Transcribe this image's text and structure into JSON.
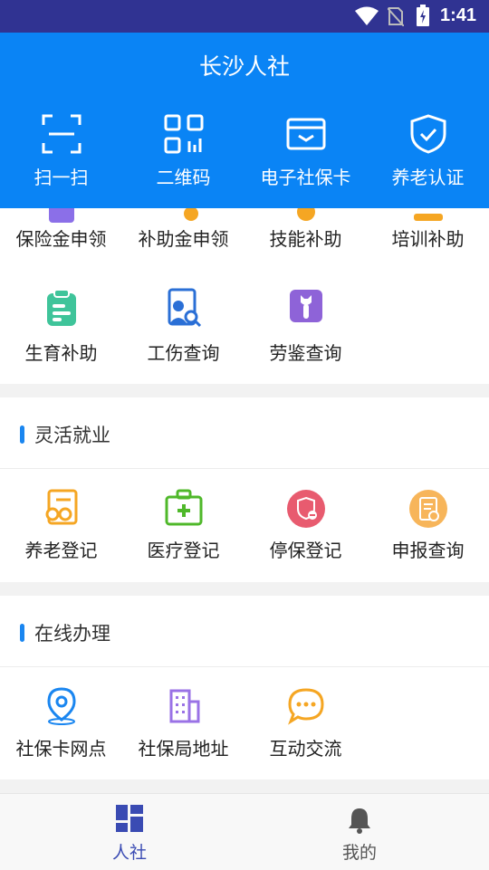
{
  "status_bar": {
    "time": "1:41"
  },
  "header": {
    "title": "长沙人社",
    "quick_actions": [
      {
        "label": "扫一扫",
        "icon": "scan-icon"
      },
      {
        "label": "二维码",
        "icon": "qrcode-icon"
      },
      {
        "label": "电子社保卡",
        "icon": "card-icon"
      },
      {
        "label": "养老认证",
        "icon": "shield-check-icon"
      }
    ]
  },
  "services": {
    "row1": [
      "保险金申领",
      "补助金申领",
      "技能补助",
      "培训补助"
    ],
    "row2": [
      "生育补助",
      "工伤查询",
      "劳鉴查询"
    ]
  },
  "flexible_employment": {
    "title": "灵活就业",
    "items": [
      "养老登记",
      "医疗登记",
      "停保登记",
      "申报查询"
    ]
  },
  "online": {
    "title": "在线办理",
    "items": [
      "社保卡网点",
      "社保局地址",
      "互动交流"
    ]
  },
  "tabbar": {
    "tabs": [
      {
        "label": "人社",
        "active": true
      },
      {
        "label": "我的",
        "active": false
      }
    ],
    "colors": {
      "active": "#3a4bb3",
      "inactive": "#555555"
    }
  }
}
